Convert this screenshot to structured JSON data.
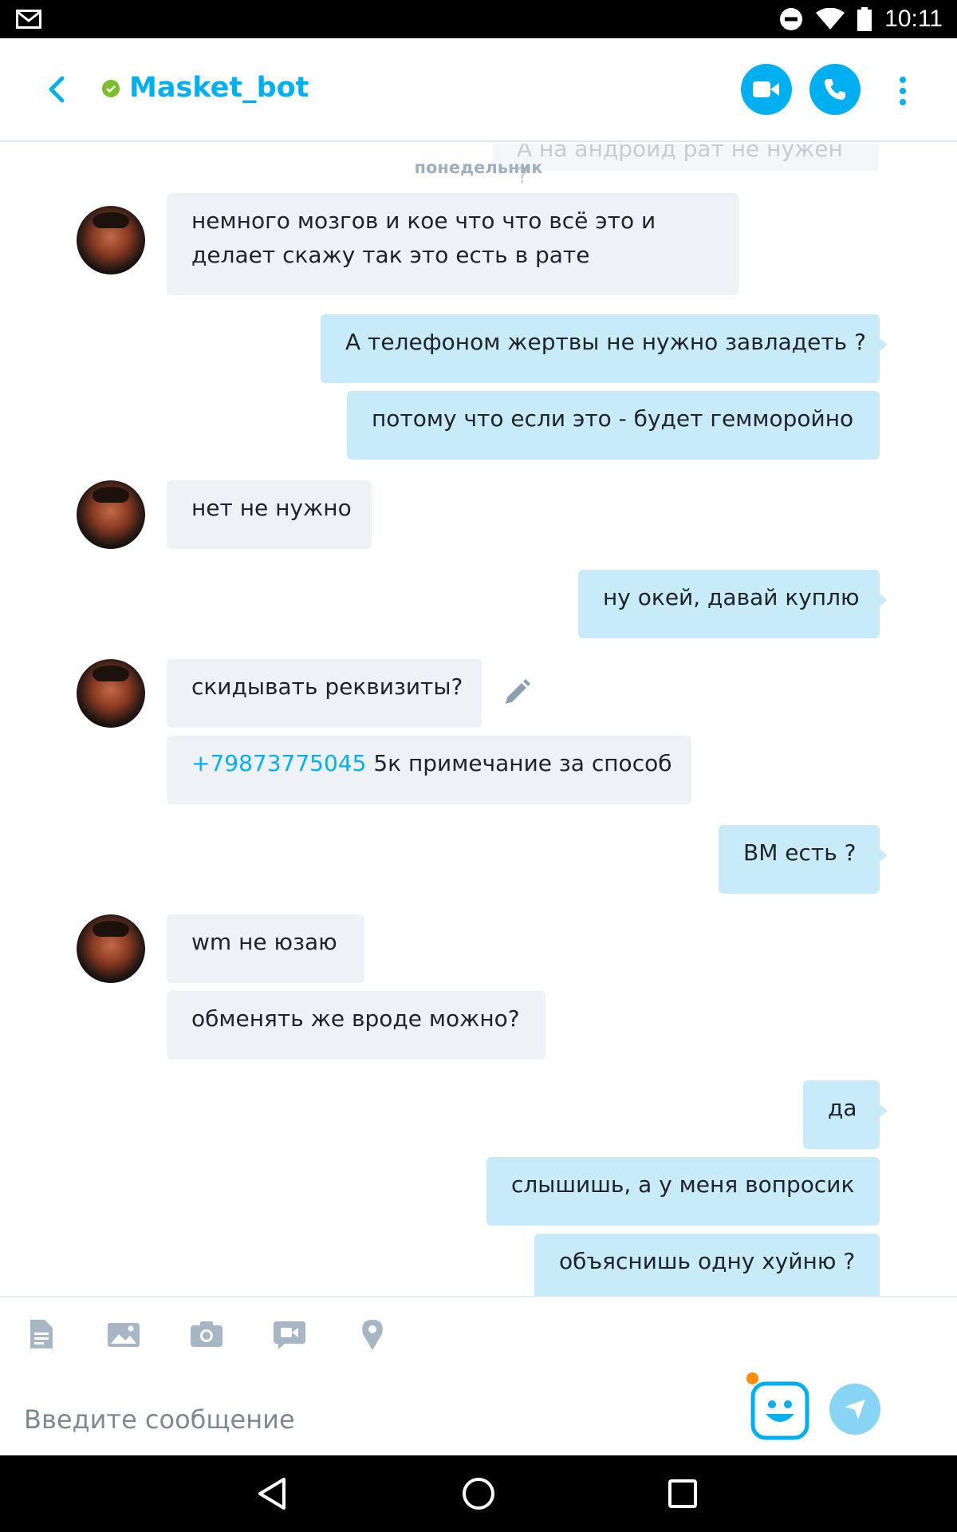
{
  "status_bar": {
    "time": "10:11"
  },
  "header": {
    "contact_name": "Masket_bot",
    "status": "online"
  },
  "chat": {
    "ghost_message": "А на андроид рат не нужен ?",
    "day_label": "понедельник",
    "messages": [
      {
        "dir": "in",
        "lines": [
          "немного мозгов и кое что что всё это и",
          "делает скажу так это есть в рате"
        ]
      },
      {
        "dir": "out",
        "text": "А телефоном жертвы не нужно завладеть ?"
      },
      {
        "dir": "out",
        "text": "потому что если это - будет гемморойно"
      },
      {
        "dir": "in",
        "text": "нет не нужно"
      },
      {
        "dir": "out",
        "text": "ну окей, давай куплю"
      },
      {
        "dir": "in",
        "text": "скидывать реквизиты?"
      },
      {
        "dir": "in",
        "phone": "+79873775045",
        "text": " 5к примечание за способ"
      },
      {
        "dir": "out",
        "text": "ВМ есть ?"
      },
      {
        "dir": "in",
        "text": "wm не юзаю"
      },
      {
        "dir": "in",
        "text": "обменять же вроде можно?"
      },
      {
        "dir": "out",
        "text": "да"
      },
      {
        "dir": "out",
        "text": "слышишь, а у меня вопросик"
      },
      {
        "dir": "out",
        "text": "объяснишь одну хуйню ?"
      }
    ]
  },
  "compose": {
    "placeholder": "Введите сообщение",
    "tools": [
      "file-icon",
      "gallery-icon",
      "camera-icon",
      "video-message-icon",
      "location-icon"
    ]
  },
  "colors": {
    "accent": "#00aff0",
    "incoming_bubble": "#eef2f6",
    "outgoing_bubble": "#c8ebf9",
    "online": "#7cbf2a",
    "notification": "#ff8c00"
  }
}
